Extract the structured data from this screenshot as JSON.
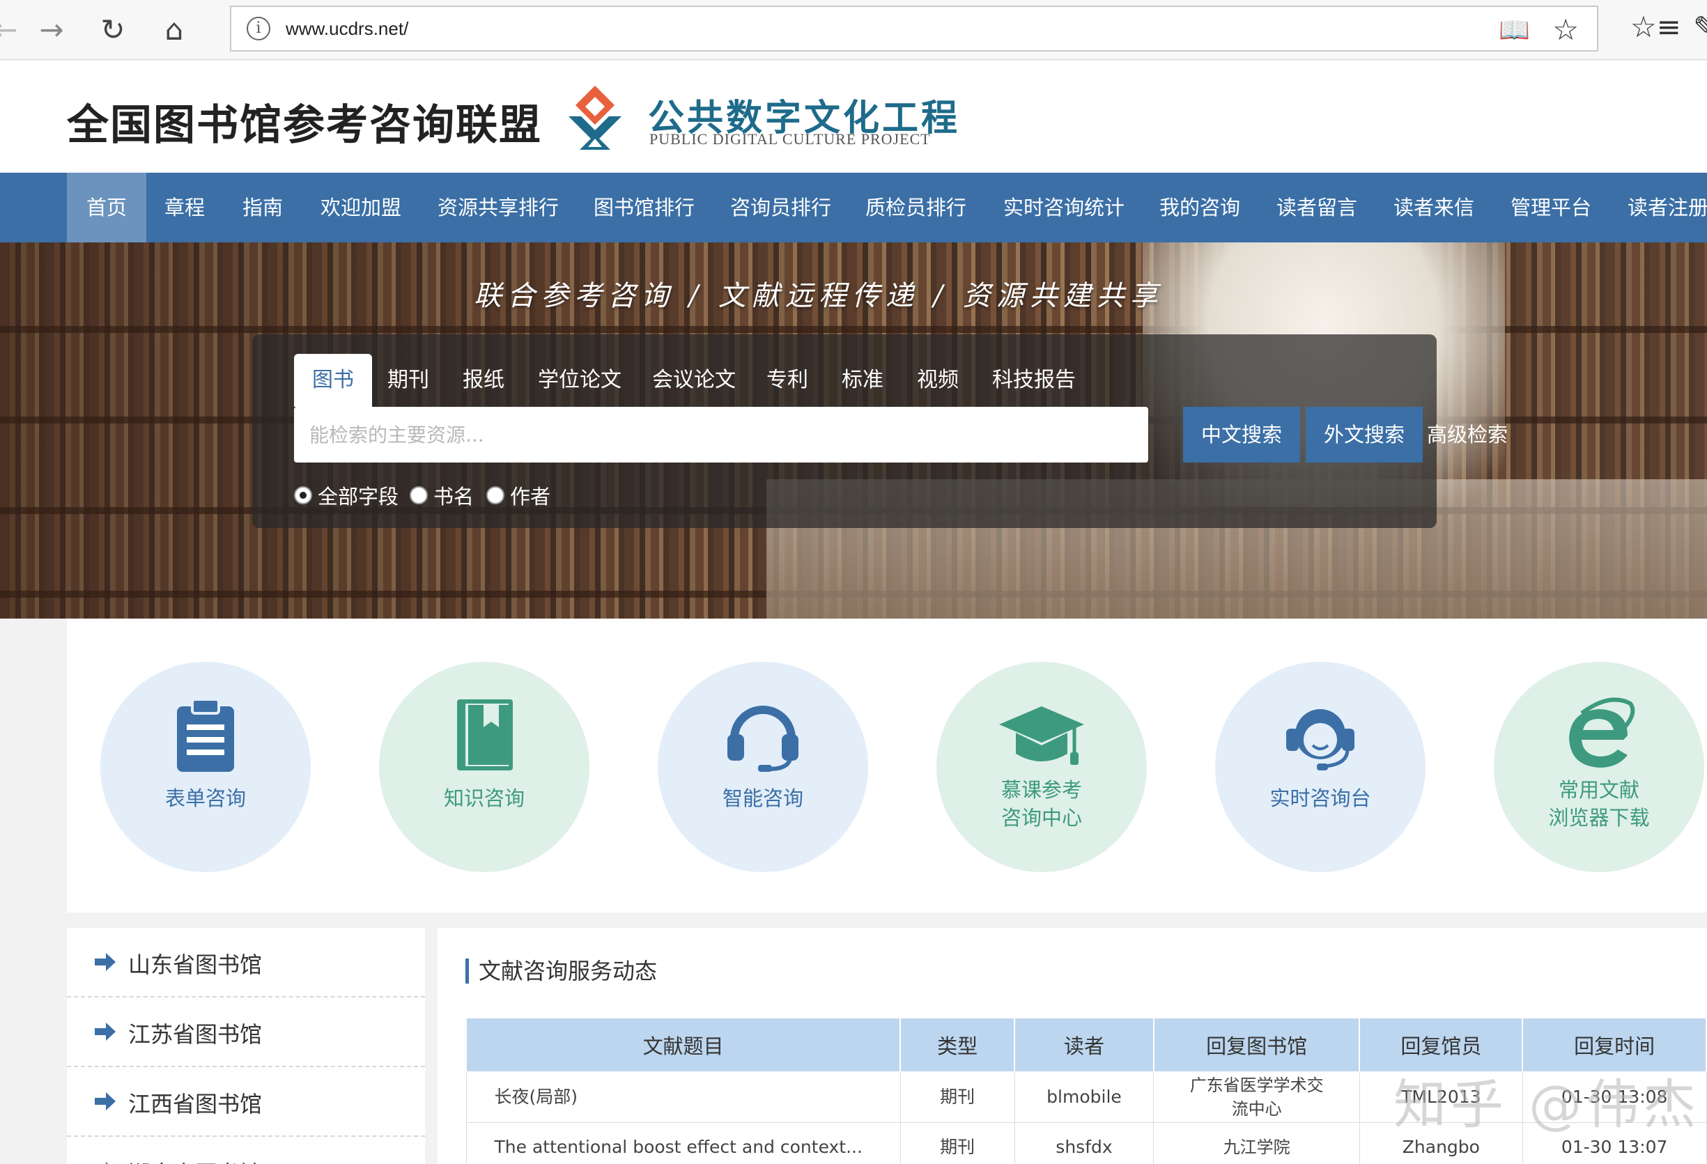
{
  "browser": {
    "url": "www.ucdrs.net/"
  },
  "header": {
    "site_title": "全国图书馆参考咨询联盟",
    "logo_cn": "公共数字文化工程",
    "logo_en": "PUBLIC DIGITAL CULTURE PROJECT"
  },
  "nav": [
    {
      "label": "首页",
      "active": true
    },
    {
      "label": "章程"
    },
    {
      "label": "指南"
    },
    {
      "label": "欢迎加盟"
    },
    {
      "label": "资源共享排行"
    },
    {
      "label": "图书馆排行"
    },
    {
      "label": "咨询员排行"
    },
    {
      "label": "质检员排行"
    },
    {
      "label": "实时咨询统计"
    },
    {
      "label": "我的咨询"
    },
    {
      "label": "读者留言"
    },
    {
      "label": "读者来信"
    },
    {
      "label": "管理平台"
    },
    {
      "label": "读者注册"
    }
  ],
  "banner": {
    "slogan": "联合参考咨询 / 文献远程传递 / 资源共建共享"
  },
  "search": {
    "tabs": [
      "图书",
      "期刊",
      "报纸",
      "学位论文",
      "会议论文",
      "专利",
      "标准",
      "视频",
      "科技报告"
    ],
    "active_tab": "图书",
    "placeholder": "能检索的主要资源...",
    "btn_cn": "中文搜索",
    "btn_foreign": "外文搜索",
    "advanced": "高级检索",
    "radios": [
      "全部字段",
      "书名",
      "作者"
    ],
    "selected_radio": "全部字段"
  },
  "services": [
    {
      "line1": "表单咨询",
      "line2": "",
      "icon": "clipboard-icon",
      "color": "#3b6fa6"
    },
    {
      "line1": "知识咨询",
      "line2": "",
      "icon": "book-icon",
      "color": "#3d9a7e"
    },
    {
      "line1": "智能咨询",
      "line2": "",
      "icon": "headset-icon",
      "color": "#3b6fa6"
    },
    {
      "line1": "慕课参考",
      "line2": "咨询中心",
      "icon": "graduation-cap-icon",
      "color": "#3d9a7e"
    },
    {
      "line1": "实时咨询台",
      "line2": "",
      "icon": "agent-icon",
      "color": "#3b6fa6"
    },
    {
      "line1": "常用文献",
      "line2": "浏览器下载",
      "icon": "ie-browser-icon",
      "color": "#3d9a7e"
    }
  ],
  "libraries": [
    "山东省图书馆",
    "江苏省图书馆",
    "江西省图书馆",
    "湖南省图书馆"
  ],
  "panel": {
    "title": "文献咨询服务动态",
    "columns": [
      "文献题目",
      "类型",
      "读者",
      "回复图书馆",
      "回复馆员",
      "回复时间"
    ],
    "rows": [
      {
        "title": "长夜(局部)",
        "type": "期刊",
        "reader": "blmobile",
        "library": "广东省医学学术交\n流中心",
        "librarian": "TML2013",
        "time": "01-30 13:08"
      },
      {
        "title": "The attentional boost effect and context...",
        "type": "期刊",
        "reader": "shsfdx",
        "library": "九江学院",
        "librarian": "Zhangbo",
        "time": "01-30 13:07"
      }
    ]
  },
  "watermark": "知乎 @伟杰"
}
